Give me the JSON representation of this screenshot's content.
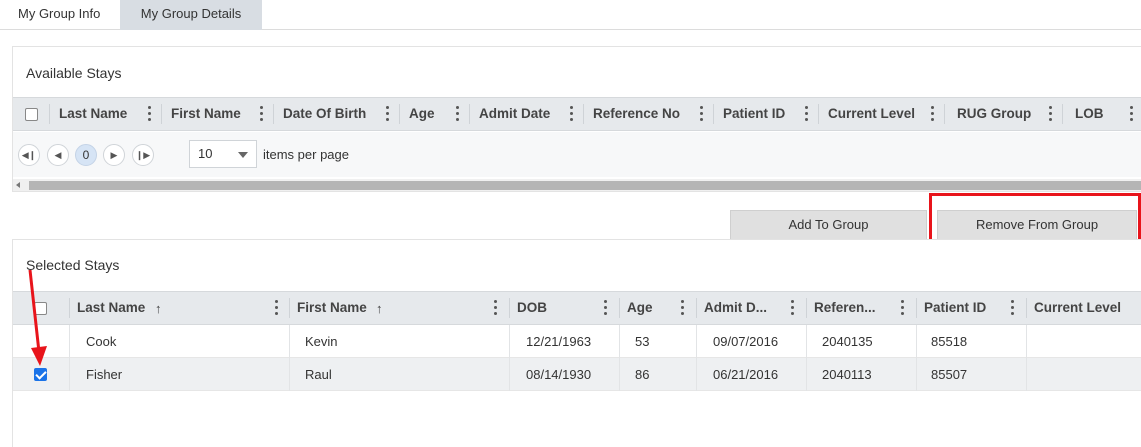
{
  "tabs": [
    {
      "label": "My Group Info",
      "active": false
    },
    {
      "label": "My Group Details",
      "active": true
    }
  ],
  "available": {
    "title": "Available Stays",
    "columns": [
      "Last Name",
      "First Name",
      "Date Of Birth",
      "Age",
      "Admit Date",
      "Reference No",
      "Patient ID",
      "Current Level",
      "RUG Group",
      "LOB"
    ],
    "pager": {
      "current_page": "0",
      "page_size": "10",
      "items_label": "items per page"
    }
  },
  "actions": {
    "add_label": "Add To Group",
    "remove_label": "Remove From Group"
  },
  "selected": {
    "title": "Selected Stays",
    "columns": [
      "Last Name",
      "First Name",
      "DOB",
      "Age",
      "Admit D...",
      "Referen...",
      "Patient ID",
      "Current Level"
    ],
    "rows": [
      {
        "last_name": "Cook",
        "first_name": "Kevin",
        "dob": "12/21/1963",
        "age": "53",
        "admit": "09/07/2016",
        "ref": "2040135",
        "patient_id": "85518",
        "checked": false
      },
      {
        "last_name": "Fisher",
        "first_name": "Raul",
        "dob": "08/14/1930",
        "age": "86",
        "admit": "06/21/2016",
        "ref": "2040113",
        "patient_id": "85507",
        "checked": true
      }
    ]
  },
  "colors": {
    "accent": "#1a73e8",
    "annotation": "#e8141b",
    "header_bg": "#e6e9ec"
  }
}
